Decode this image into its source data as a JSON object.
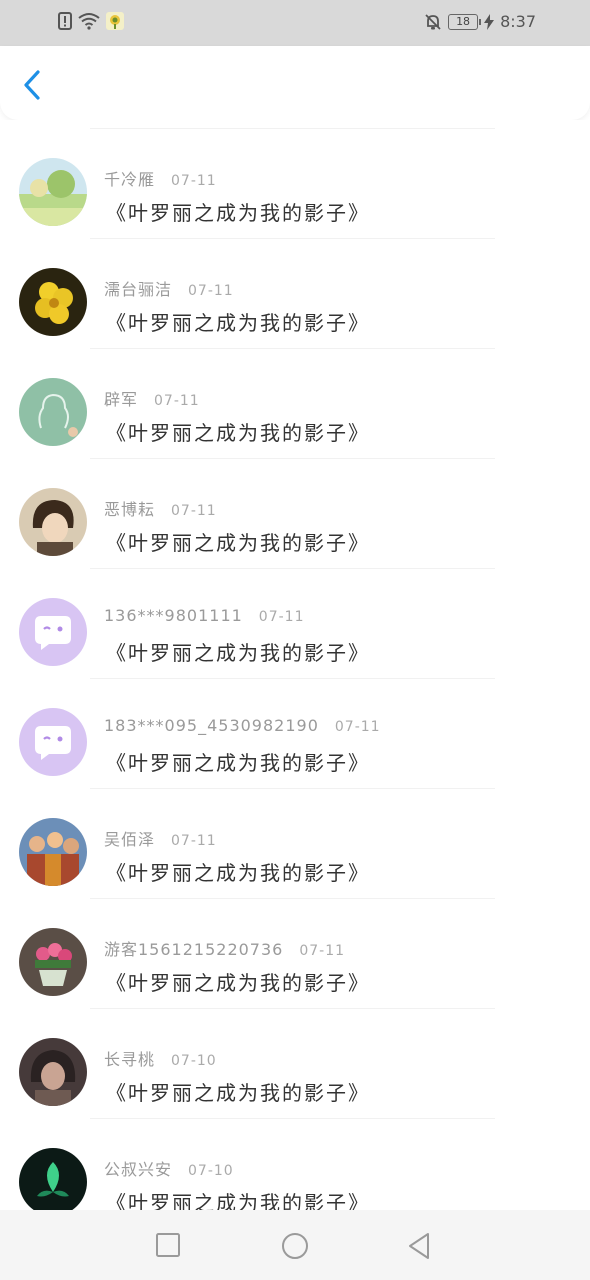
{
  "status_bar": {
    "time": "8:37",
    "battery": "18",
    "icons": [
      "alert-icon",
      "wifi-icon",
      "app-notification-icon",
      "mute-bell-icon",
      "battery-icon",
      "charging-icon"
    ]
  },
  "header": {
    "back_icon": "chevron-left-icon",
    "accent": "#1e90e6"
  },
  "comments": [
    {
      "name": "千冷雁",
      "date": "07-11",
      "text": "《叶罗丽之成为我的影子》",
      "avatar": "landscape-avatar"
    },
    {
      "name": "濡台骊洁",
      "date": "07-11",
      "text": "《叶罗丽之成为我的影子》",
      "avatar": "flower-avatar"
    },
    {
      "name": "辟军",
      "date": "07-11",
      "text": "《叶罗丽之成为我的影子》",
      "avatar": "chalkboard-avatar"
    },
    {
      "name": "恶博耘",
      "date": "07-11",
      "text": "《叶罗丽之成为我的影子》",
      "avatar": "anime-boy-avatar"
    },
    {
      "name": "136***9801111",
      "date": "07-11",
      "text": "《叶罗丽之成为我的影子》",
      "avatar": "default-chat-avatar"
    },
    {
      "name": "183***095_4530982190",
      "date": "07-11",
      "text": "《叶罗丽之成为我的影子》",
      "avatar": "default-chat-avatar"
    },
    {
      "name": "吴佰泽",
      "date": "07-11",
      "text": "《叶罗丽之成为我的影子》",
      "avatar": "group-avatar"
    },
    {
      "name": "游客1561215220736",
      "date": "07-11",
      "text": "《叶罗丽之成为我的影子》",
      "avatar": "flower-pot-avatar"
    },
    {
      "name": "长寻桃",
      "date": "07-10",
      "text": "《叶罗丽之成为我的影子》",
      "avatar": "anime-girl-avatar"
    },
    {
      "name": "公叔兴安",
      "date": "07-10",
      "text": "《叶罗丽之成为我的影子》",
      "avatar": "green-leaf-avatar"
    }
  ],
  "nav_bar": {
    "icons": [
      "recent-apps-icon",
      "home-icon",
      "back-icon"
    ]
  }
}
